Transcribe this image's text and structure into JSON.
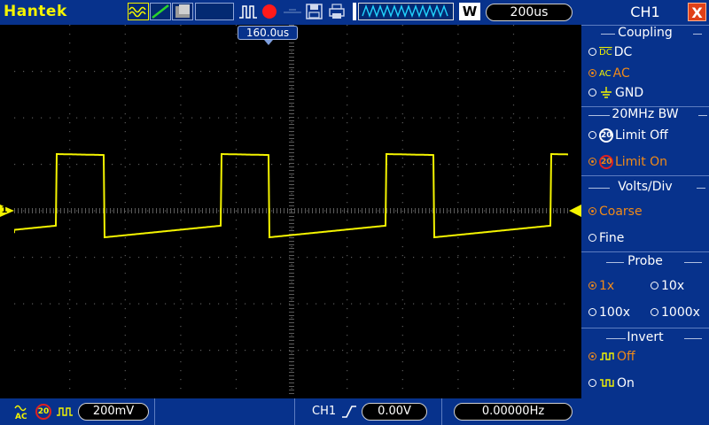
{
  "topbar": {
    "brand": "Hantek",
    "icons": [
      "waveform-display-icon",
      "vector-dots-icon",
      "persistence-icon",
      "trigger-pulse-icon",
      "stop-record-icon",
      "storage-icon",
      "print-icon",
      "horizontal-position-icon",
      "window-icon"
    ],
    "window_label": "W",
    "timebase": "200us"
  },
  "screen": {
    "trigger_time_label": "160.0us",
    "channel_marker": "1",
    "waveform_color": "#f4f400",
    "grid_color": "#5a5a5a"
  },
  "bottombar": {
    "coupling_icon": "AC",
    "bw_icon": "20",
    "volts_div": "200mV",
    "trigger_source": "CH1",
    "trigger_level": "0.00V",
    "frequency": "0.00000Hz"
  },
  "panel": {
    "title": "CH1",
    "close_label": "X",
    "coupling": {
      "title": "Coupling",
      "options": [
        {
          "label": "DC",
          "icon": "DC",
          "selected": false
        },
        {
          "label": "AC",
          "icon": "AC",
          "selected": true
        },
        {
          "label": "GND",
          "icon": "gnd",
          "selected": false
        }
      ]
    },
    "bw": {
      "title": "20MHz BW",
      "options": [
        {
          "label": "Limit Off",
          "icon": "20",
          "selected": false
        },
        {
          "label": "Limit On",
          "icon": "20",
          "selected": true
        }
      ]
    },
    "volts": {
      "title": "Volts/Div",
      "options": [
        {
          "label": "Coarse",
          "selected": true
        },
        {
          "label": "Fine",
          "selected": false
        }
      ]
    },
    "probe": {
      "title": "Probe",
      "options": [
        {
          "label": "1x",
          "selected": true
        },
        {
          "label": "10x",
          "selected": false
        },
        {
          "label": "100x",
          "selected": false
        },
        {
          "label": "1000x",
          "selected": false
        }
      ]
    },
    "invert": {
      "title": "Invert",
      "options": [
        {
          "label": "Off",
          "selected": true
        },
        {
          "label": "On",
          "selected": false
        }
      ]
    }
  }
}
